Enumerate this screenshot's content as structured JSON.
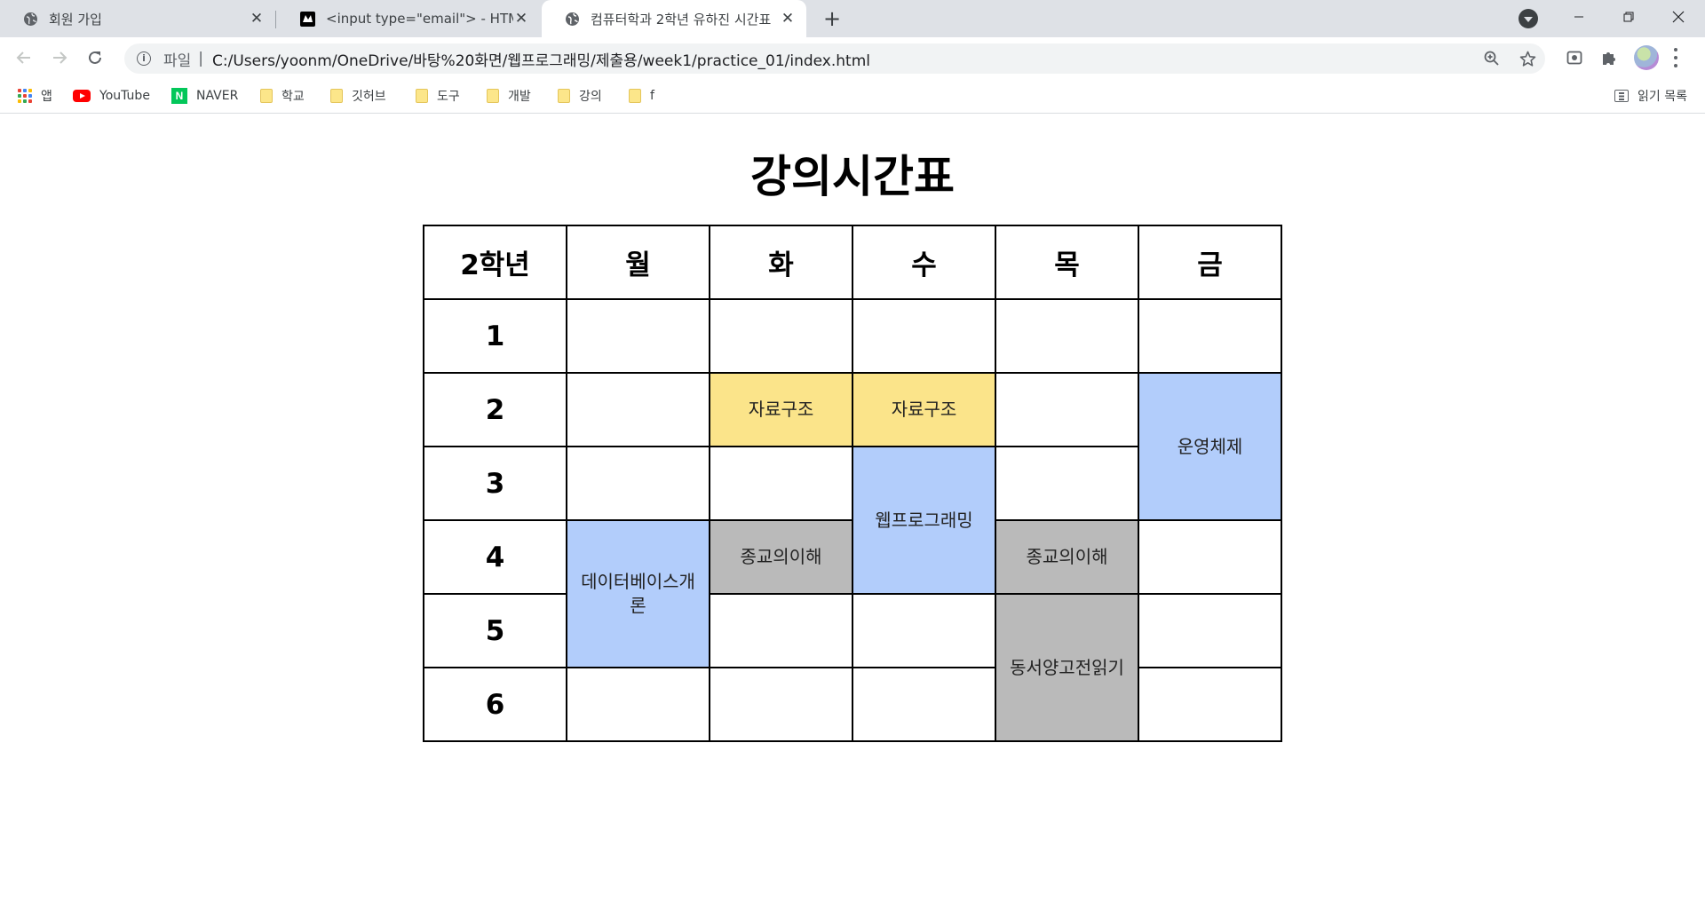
{
  "browser": {
    "tabs": [
      {
        "title": "회원 가입",
        "icon": "globe-icon",
        "active": false
      },
      {
        "title": "<input type=\"email\"> - HTML: H",
        "icon": "mdn-logo-icon",
        "active": false
      },
      {
        "title": "컴퓨터학과 2학년 유하진 시간표",
        "icon": "globe-icon",
        "active": true
      }
    ],
    "close_glyph": "✕",
    "address": {
      "scheme": "파일",
      "separator": "|",
      "url": "C:/Users/yoonm/OneDrive/바탕%20화면/웹프로그래밍/제출용/week1/practice_01/index.html"
    },
    "bookmarks": [
      {
        "label": "앱",
        "icon": "apps-grid-icon"
      },
      {
        "label": "YouTube",
        "icon": "youtube-icon"
      },
      {
        "label": "NAVER",
        "icon": "naver-icon"
      },
      {
        "label": "학교",
        "icon": "folder-icon"
      },
      {
        "label": "깃허브",
        "icon": "folder-icon"
      },
      {
        "label": "도구",
        "icon": "folder-icon"
      },
      {
        "label": "개발",
        "icon": "folder-icon"
      },
      {
        "label": "강의",
        "icon": "folder-icon"
      },
      {
        "label": "f",
        "icon": "folder-icon"
      }
    ],
    "reading_list": "읽기 목록"
  },
  "page": {
    "title": "강의시간표",
    "header": [
      "2학년",
      "월",
      "화",
      "수",
      "목",
      "금"
    ],
    "periods": [
      "1",
      "2",
      "3",
      "4",
      "5",
      "6"
    ],
    "courses": {
      "data_structure": "자료구조",
      "operating_system": "운영체제",
      "web_programming": "웹프로그래밍",
      "religion": "종교의이해",
      "database": "데이터베이스개론",
      "classics": "동서양고전읽기"
    },
    "colors": {
      "yellow": "#fbe48a",
      "blue": "#b2cdfb",
      "gray": "#bababa"
    }
  }
}
